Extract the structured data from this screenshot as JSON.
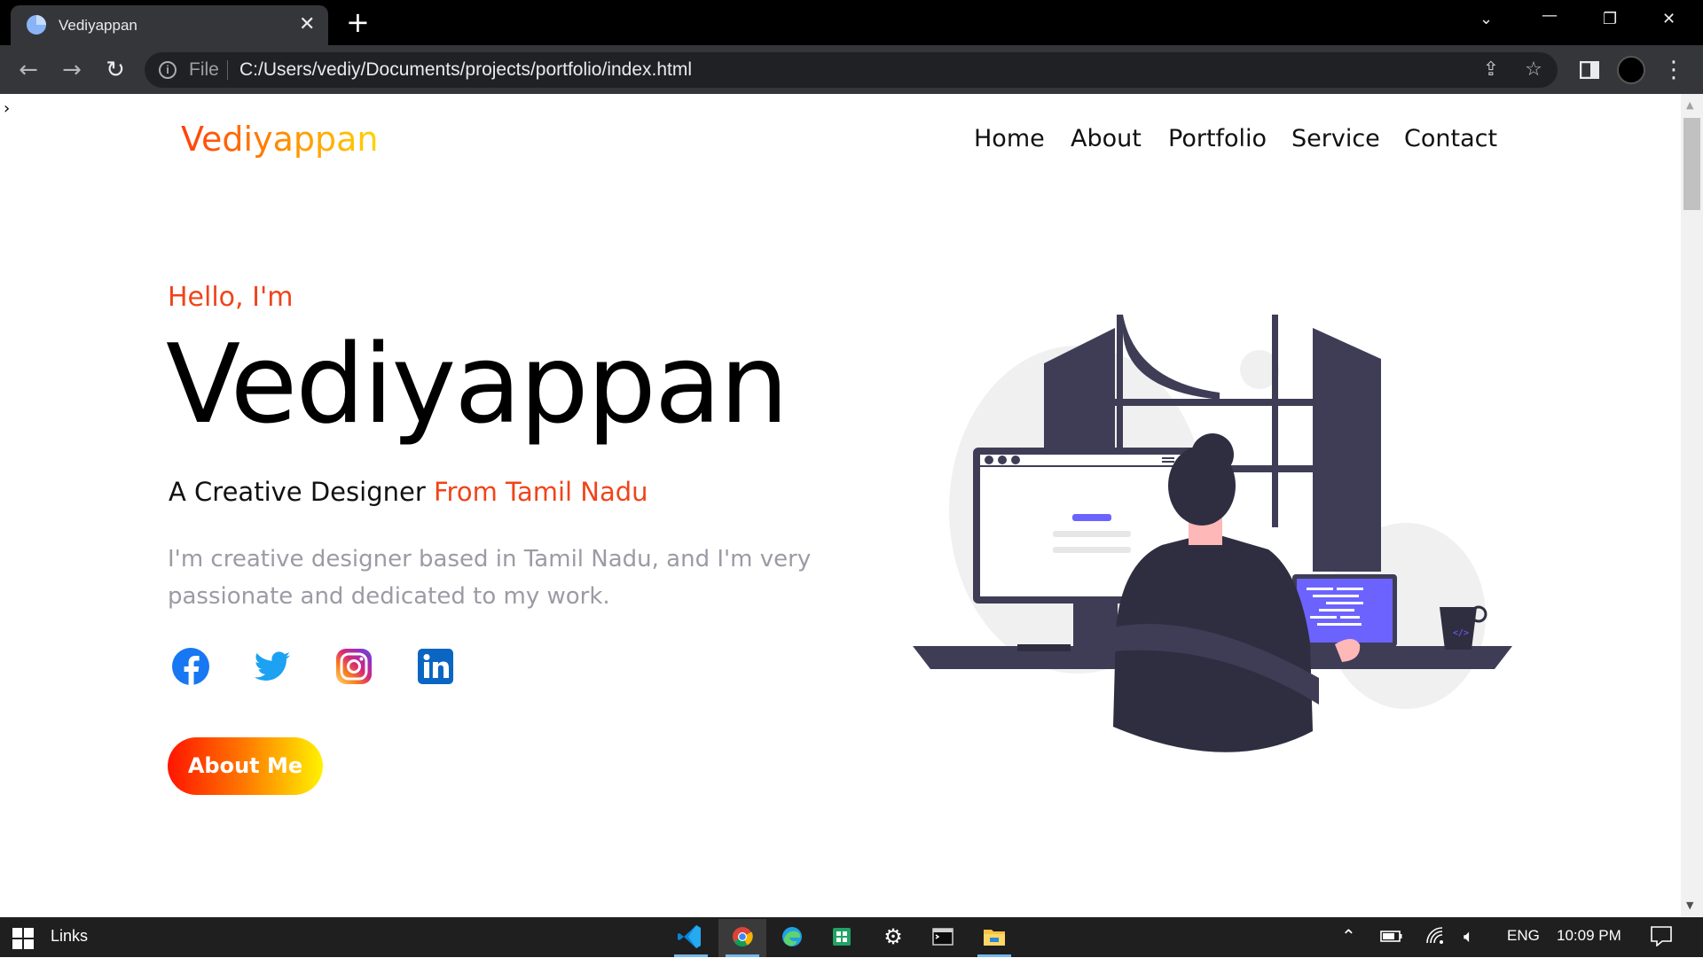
{
  "browser": {
    "tab_title": "Vediyappan",
    "tab_close": "✕",
    "new_tab": "+",
    "url_scheme": "File",
    "url": "C:/Users/vediy/Documents/projects/portfolio/index.html",
    "icons": [
      "back-arrow-icon",
      "forward-arrow-icon",
      "reload-icon",
      "info-icon",
      "share-icon",
      "bookmark-star-icon",
      "side-panel-icon",
      "profile-avatar",
      "more-menu-icon"
    ]
  },
  "page": {
    "logo": "Vediyappan",
    "nav": [
      "Home",
      "About",
      "Portfolio",
      "Service",
      "Contact"
    ],
    "hero": {
      "greeting": "Hello, I'm",
      "name": "Vediyappan",
      "tagline_prefix": "A Creative Designer ",
      "tagline_highlight": "From Tamil Nadu",
      "bio": "I'm creative designer based in Tamil Nadu, and I'm very passionate and dedicated to my work.",
      "button": "About Me"
    },
    "social": [
      "facebook-icon",
      "twitter-icon",
      "instagram-icon",
      "linkedin-icon"
    ],
    "colors": {
      "accent": "#f0441a",
      "logo_start": "#ff3f0f",
      "logo_end": "#ffd400",
      "illustration_dark": "#3f3d56",
      "illustration_purple": "#6c63ff"
    }
  },
  "taskbar": {
    "links_label": "Links",
    "apps": [
      "vscode-icon",
      "chrome-icon",
      "edge-icon",
      "sheets-icon",
      "settings-icon",
      "terminal-icon",
      "file-explorer-icon"
    ],
    "language": "ENG",
    "time": "10:09 PM"
  }
}
